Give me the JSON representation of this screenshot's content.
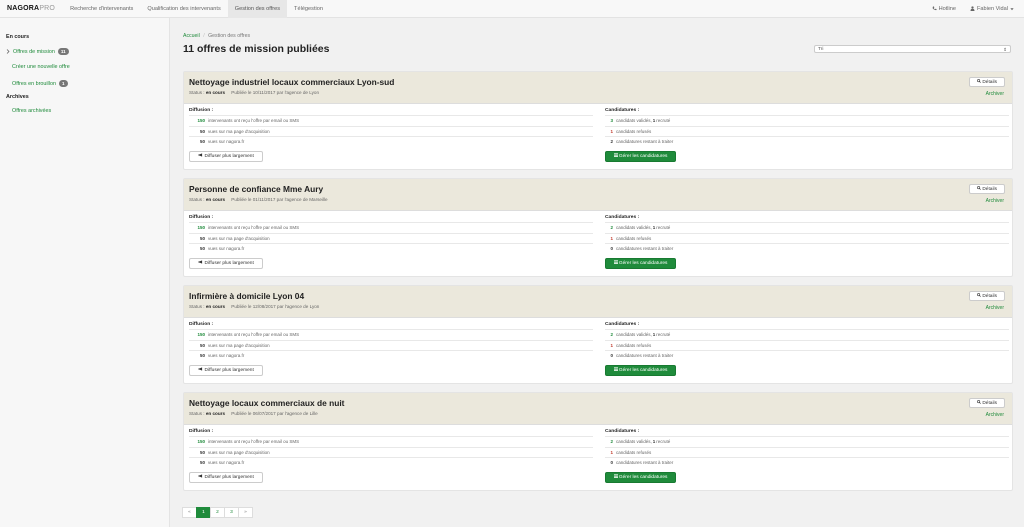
{
  "brand": {
    "name": "NAGORA",
    "suffix": "PRO"
  },
  "nav": [
    {
      "label": "Recherche d'intervenants",
      "active": false
    },
    {
      "label": "Qualification des intervenants",
      "active": false
    },
    {
      "label": "Gestion des offres",
      "active": true
    },
    {
      "label": "Télégestion",
      "active": false
    }
  ],
  "topright": {
    "hotline": "Hotline",
    "user": "Fabien Vidal"
  },
  "sidebar": {
    "section1": "En cours",
    "missions_label": "Offres de mission",
    "missions_count": "11",
    "create_label": "Créer une nouvelle offre",
    "drafts_label": "Offres en brouillon",
    "drafts_count": "1",
    "section2": "Archives",
    "archived_label": "Offres archivées"
  },
  "breadcrumb": {
    "home": "Accueil",
    "current": "Gestion des offres"
  },
  "page_title": "11 offres de mission publiées",
  "sort": {
    "value": "Tri"
  },
  "common": {
    "details": "Détails",
    "archive": "Archiver",
    "diffusion_h": "Diffusion :",
    "candidatures_h": "Candidatures :",
    "diffuser_btn": "Diffuser plus largement",
    "gerer_btn": "Gérer les candidatures",
    "status_prefix": "Status : ",
    "diff_row1": "intervenants ont reçu l'offre par email ou SMS",
    "diff_row2": "vues sur ma page d'acquisition",
    "diff_row3": "vues sur nagora.fr",
    "cand_row1a": "candidats validés, ",
    "cand_row1b": "recruté",
    "cand_row2": "candidats refusés",
    "cand_row3": "candidatures restant à traiter"
  },
  "offers": [
    {
      "title": "Nettoyage industriel locaux commerciaux Lyon-sud",
      "status": "en cours",
      "published": "Publiée le 10/11/2017 par l'agence de Lyon",
      "emails": "150",
      "views_page": "50",
      "views_site": "50",
      "validated": "3",
      "recruited": "1",
      "refused": "1",
      "pending": "2"
    },
    {
      "title": "Personne de confiance Mme Aury",
      "status": "en cours",
      "published": "Publiée le 01/11/2017 par l'agence de Marseille",
      "emails": "150",
      "views_page": "50",
      "views_site": "50",
      "validated": "2",
      "recruited": "1",
      "refused": "1",
      "pending": "0"
    },
    {
      "title": "Infirmière à domicile Lyon 04",
      "status": "en cours",
      "published": "Publiée le 12/08/2017 par l'agence de Lyon",
      "emails": "150",
      "views_page": "50",
      "views_site": "50",
      "validated": "2",
      "recruited": "1",
      "refused": "1",
      "pending": "0"
    },
    {
      "title": "Nettoyage locaux commerciaux de nuit",
      "status": "en cours",
      "published": "Publiée le 06/07/2017 par l'agence de Lille",
      "emails": "150",
      "views_page": "50",
      "views_site": "50",
      "validated": "2",
      "recruited": "1",
      "refused": "1",
      "pending": "0"
    }
  ],
  "pagination": {
    "prev": "«",
    "pages": [
      "1",
      "2",
      "3"
    ],
    "active": "1",
    "next": "»"
  },
  "colors": {
    "accent": "#1f8b3b",
    "card_header": "#ebe8dc",
    "danger": "#c0392b"
  }
}
